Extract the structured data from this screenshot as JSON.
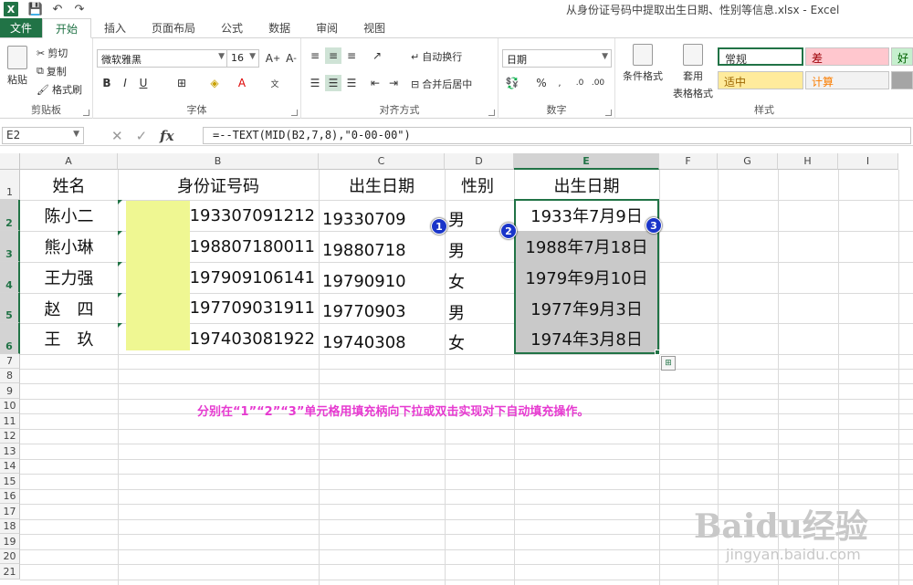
{
  "titlebar": {
    "logo": "X",
    "title": "从身份证号码中提取出生日期、性别等信息.xlsx - Excel",
    "icons": [
      "save-icon",
      "undo-icon",
      "redo-icon"
    ]
  },
  "tabs": [
    "文件",
    "开始",
    "插入",
    "页面布局",
    "公式",
    "数据",
    "审阅",
    "视图"
  ],
  "ribbon": {
    "clipboard": {
      "label": "剪贴板",
      "paste": "粘贴",
      "cut": "剪切",
      "copy": "复制",
      "painter": "格式刷"
    },
    "font": {
      "label": "字体",
      "name": "微软雅黑",
      "size": "16",
      "bold": "B",
      "italic": "I",
      "underline": "U"
    },
    "align": {
      "label": "对齐方式",
      "wrap": "自动换行",
      "merge": "合并后居中"
    },
    "number": {
      "label": "数字",
      "format": "日期",
      "percent": "%"
    },
    "styles": {
      "label": "样式",
      "cond": "条件格式",
      "table": "套用",
      "table2": "表格格式",
      "normal": "常规",
      "bad": "差",
      "good": "好",
      "neutral": "适中",
      "calc": "计算"
    }
  },
  "formulabar": {
    "cell": "E2",
    "formula": "=--TEXT(MID(B2,7,8),\"0-00-00\")",
    "fx": "fx"
  },
  "columns": [
    "A",
    "B",
    "C",
    "D",
    "E",
    "F",
    "G",
    "H",
    "I"
  ],
  "rows": [
    "1",
    "2",
    "3",
    "4",
    "5",
    "6",
    "7",
    "8",
    "9",
    "10",
    "11",
    "12",
    "13",
    "14",
    "15",
    "16",
    "17",
    "18",
    "19",
    "20",
    "21"
  ],
  "headers": {
    "name": "姓名",
    "id": "身份证号码",
    "birth": "出生日期",
    "gender": "性别",
    "birth2": "出生日期"
  },
  "data": [
    {
      "name": "陈小二",
      "id": "193307091212",
      "birth": "19330709",
      "gender": "男",
      "date": "1933年7月9日"
    },
    {
      "name": "熊小琳",
      "id": "198807180011",
      "birth": "19880718",
      "gender": "男",
      "date": "1988年7月18日"
    },
    {
      "name": "王力强",
      "id": "197909106141",
      "birth": "19790910",
      "gender": "女",
      "date": "1979年9月10日"
    },
    {
      "name": "赵　四",
      "id": "197709031911",
      "birth": "19770903",
      "gender": "男",
      "date": "1977年9月3日"
    },
    {
      "name": "王　玖",
      "id": "197403081922",
      "birth": "19740308",
      "gender": "女",
      "date": "1974年3月8日"
    }
  ],
  "markers": [
    "1",
    "2",
    "3"
  ],
  "note": "分别在“1”“2”“3”单元格用填充柄向下拉或双击实现对下自动填充操作。",
  "watermark": "Baidu经验",
  "watermark_url": "jingyan.baidu.com"
}
